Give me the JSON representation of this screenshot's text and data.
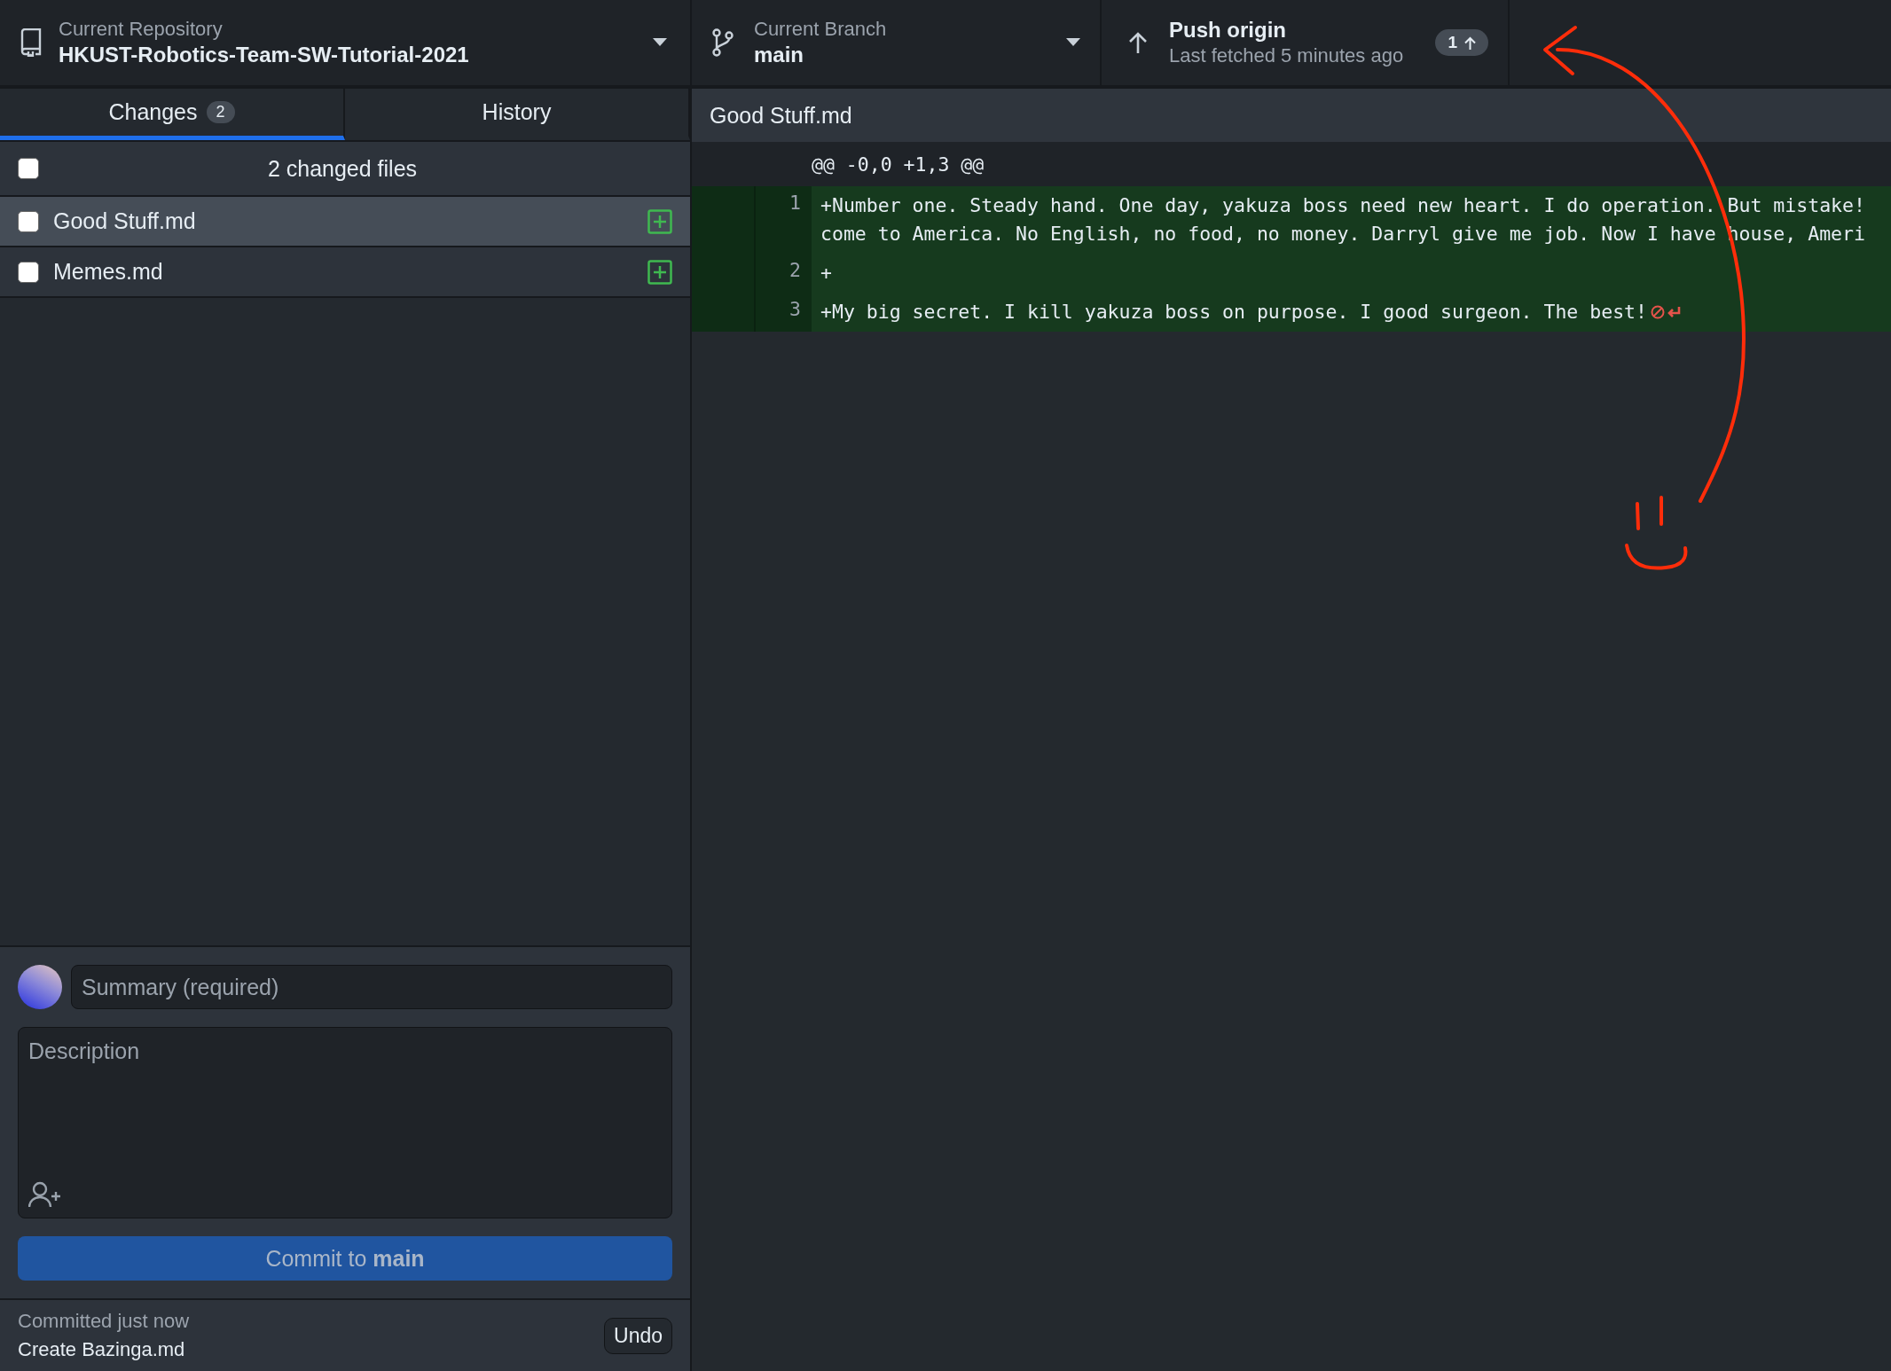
{
  "toolbar": {
    "repository": {
      "label": "Current Repository",
      "name": "HKUST-Robotics-Team-SW-Tutorial-2021"
    },
    "branch": {
      "label": "Current Branch",
      "name": "main"
    },
    "push": {
      "title": "Push origin",
      "subtitle": "Last fetched 5 minutes ago",
      "badge": "1"
    }
  },
  "tabs": [
    {
      "label": "Changes",
      "count": "2",
      "selected": true
    },
    {
      "label": "History",
      "selected": false
    }
  ],
  "changes": {
    "header": "2 changed files",
    "all_checked": false,
    "files": [
      {
        "name": "Good Stuff.md",
        "checked": false,
        "selected": true,
        "kind": "added"
      },
      {
        "name": "Memes.md",
        "checked": false,
        "selected": false,
        "kind": "added"
      }
    ]
  },
  "commit": {
    "summary": {
      "placeholder": "Summary (required)"
    },
    "description": {
      "placeholder": "Description"
    },
    "button": {
      "label": "Commit to **main**",
      "disabled": true
    }
  },
  "last_commit": {
    "label": "Committed just now",
    "message": "Create Bazinga.md",
    "undo": "Undo"
  },
  "diff": {
    "file": "Good Stuff.md",
    "hunk": "@@ -0,0 +1,3 @@",
    "lines": [
      {
        "number": "1",
        "kind": "added",
        "no_newline": false,
        "segments": [
          "+Number one. Steady hand. One day, yakuza boss need new heart. I do operation. But mistake!",
          "come to America. No English, no food, no money. Darryl give me job. Now I have house, Ameri"
        ]
      },
      {
        "number": "2",
        "kind": "added",
        "no_newline": false,
        "segments": [
          "+"
        ]
      },
      {
        "number": "3",
        "kind": "added",
        "no_newline": true,
        "segments": [
          "+My big secret. I kill yakuza boss on purpose. I good surgeon. The best!"
        ]
      }
    ]
  }
}
